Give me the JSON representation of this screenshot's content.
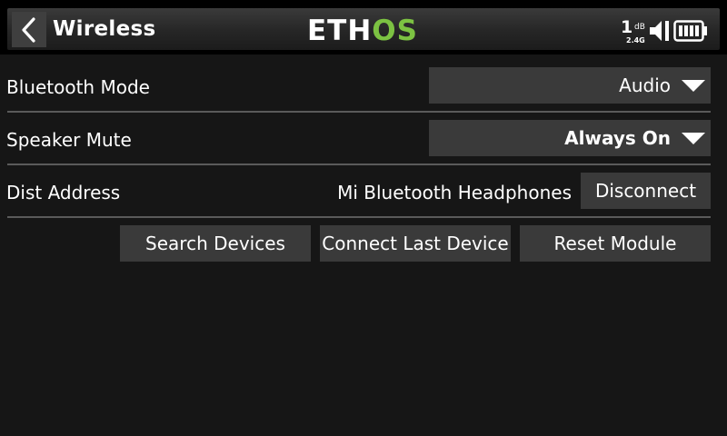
{
  "header": {
    "title": "Wireless",
    "back_icon": "chevron-left-icon",
    "logo": {
      "left": "ETH",
      "right": "OS",
      "accent": "#7cc242"
    },
    "status": {
      "rssi_value": "1",
      "rssi_unit": "dB",
      "band": "2.4G",
      "speaker_icon": "speaker-icon",
      "battery_icon": "battery-icon"
    }
  },
  "settings": {
    "bluetooth_mode": {
      "label": "Bluetooth Mode",
      "value": "Audio"
    },
    "speaker_mute": {
      "label": "Speaker Mute",
      "value": "Always On"
    },
    "dist_address": {
      "label": "Dist Address",
      "device": "Mi Bluetooth Headphones",
      "button": "Disconnect"
    }
  },
  "actions": {
    "search": "Search Devices",
    "connect_last": "Connect Last Device",
    "reset": "Reset Module"
  },
  "colors": {
    "background": "#161616",
    "control": "#3a3a3a",
    "divider": "#5a5a5a"
  }
}
